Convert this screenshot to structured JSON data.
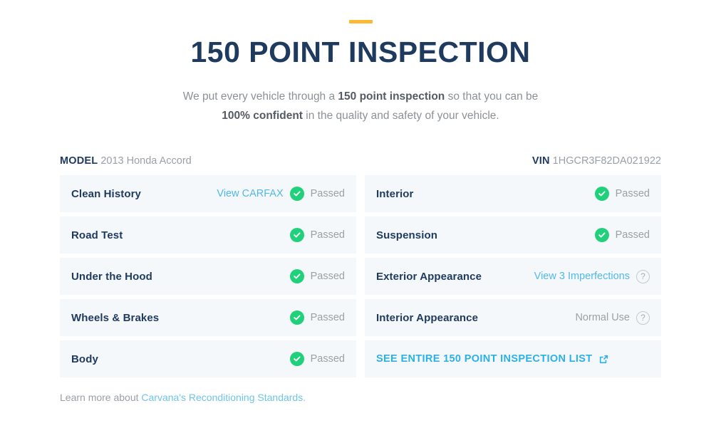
{
  "header": {
    "accent_color": "#fdb933",
    "title": "150 POINT INSPECTION",
    "subtitle_line1_pre": "We put every vehicle through a ",
    "subtitle_line1_strong": "150 point inspection",
    "subtitle_line1_post": " so that you can be",
    "subtitle_line2_strong": "100% confident",
    "subtitle_line2_post": " in the quality and safety of your vehicle."
  },
  "meta": {
    "model_label": "MODEL",
    "model_value": "2013 Honda Accord",
    "vin_label": "VIN",
    "vin_value": "1HGCR3F82DA021922"
  },
  "left_column": [
    {
      "label": "Clean History",
      "link": "View CARFAX",
      "status": "Passed",
      "badge": "check-circle-icon"
    },
    {
      "label": "Road Test",
      "link": "",
      "status": "Passed",
      "badge": "check-circle-icon"
    },
    {
      "label": "Under the Hood",
      "link": "",
      "status": "Passed",
      "badge": "check-circle-icon"
    },
    {
      "label": "Wheels & Brakes",
      "link": "",
      "status": "Passed",
      "badge": "check-circle-icon"
    },
    {
      "label": "Body",
      "link": "",
      "status": "Passed",
      "badge": "check-circle-icon"
    }
  ],
  "right_column": [
    {
      "label": "Interior",
      "link": "",
      "status": "Passed",
      "badge": "check-circle-icon"
    },
    {
      "label": "Suspension",
      "link": "",
      "status": "Passed",
      "badge": "check-circle-icon"
    },
    {
      "label": "Exterior Appearance",
      "link": "View 3 Imperfections",
      "status": "",
      "badge": "help-circle-icon"
    },
    {
      "label": "Interior Appearance",
      "link": "",
      "status": "Normal Use",
      "badge": "help-circle-icon"
    }
  ],
  "full_list": {
    "label": "SEE ENTIRE 150 POINT INSPECTION LIST",
    "icon": "external-link-icon"
  },
  "footer": {
    "text_pre": "Learn more about ",
    "link": "Carvana's Reconditioning Standards."
  },
  "colors": {
    "navy": "#1e3a5f",
    "green": "#21d07a",
    "link_blue": "#53b7e8",
    "bold_blue": "#2cb1e5",
    "row_bg": "#f5f8fb",
    "muted": "#9aa0a6",
    "accent_orange": "#fdb933"
  }
}
